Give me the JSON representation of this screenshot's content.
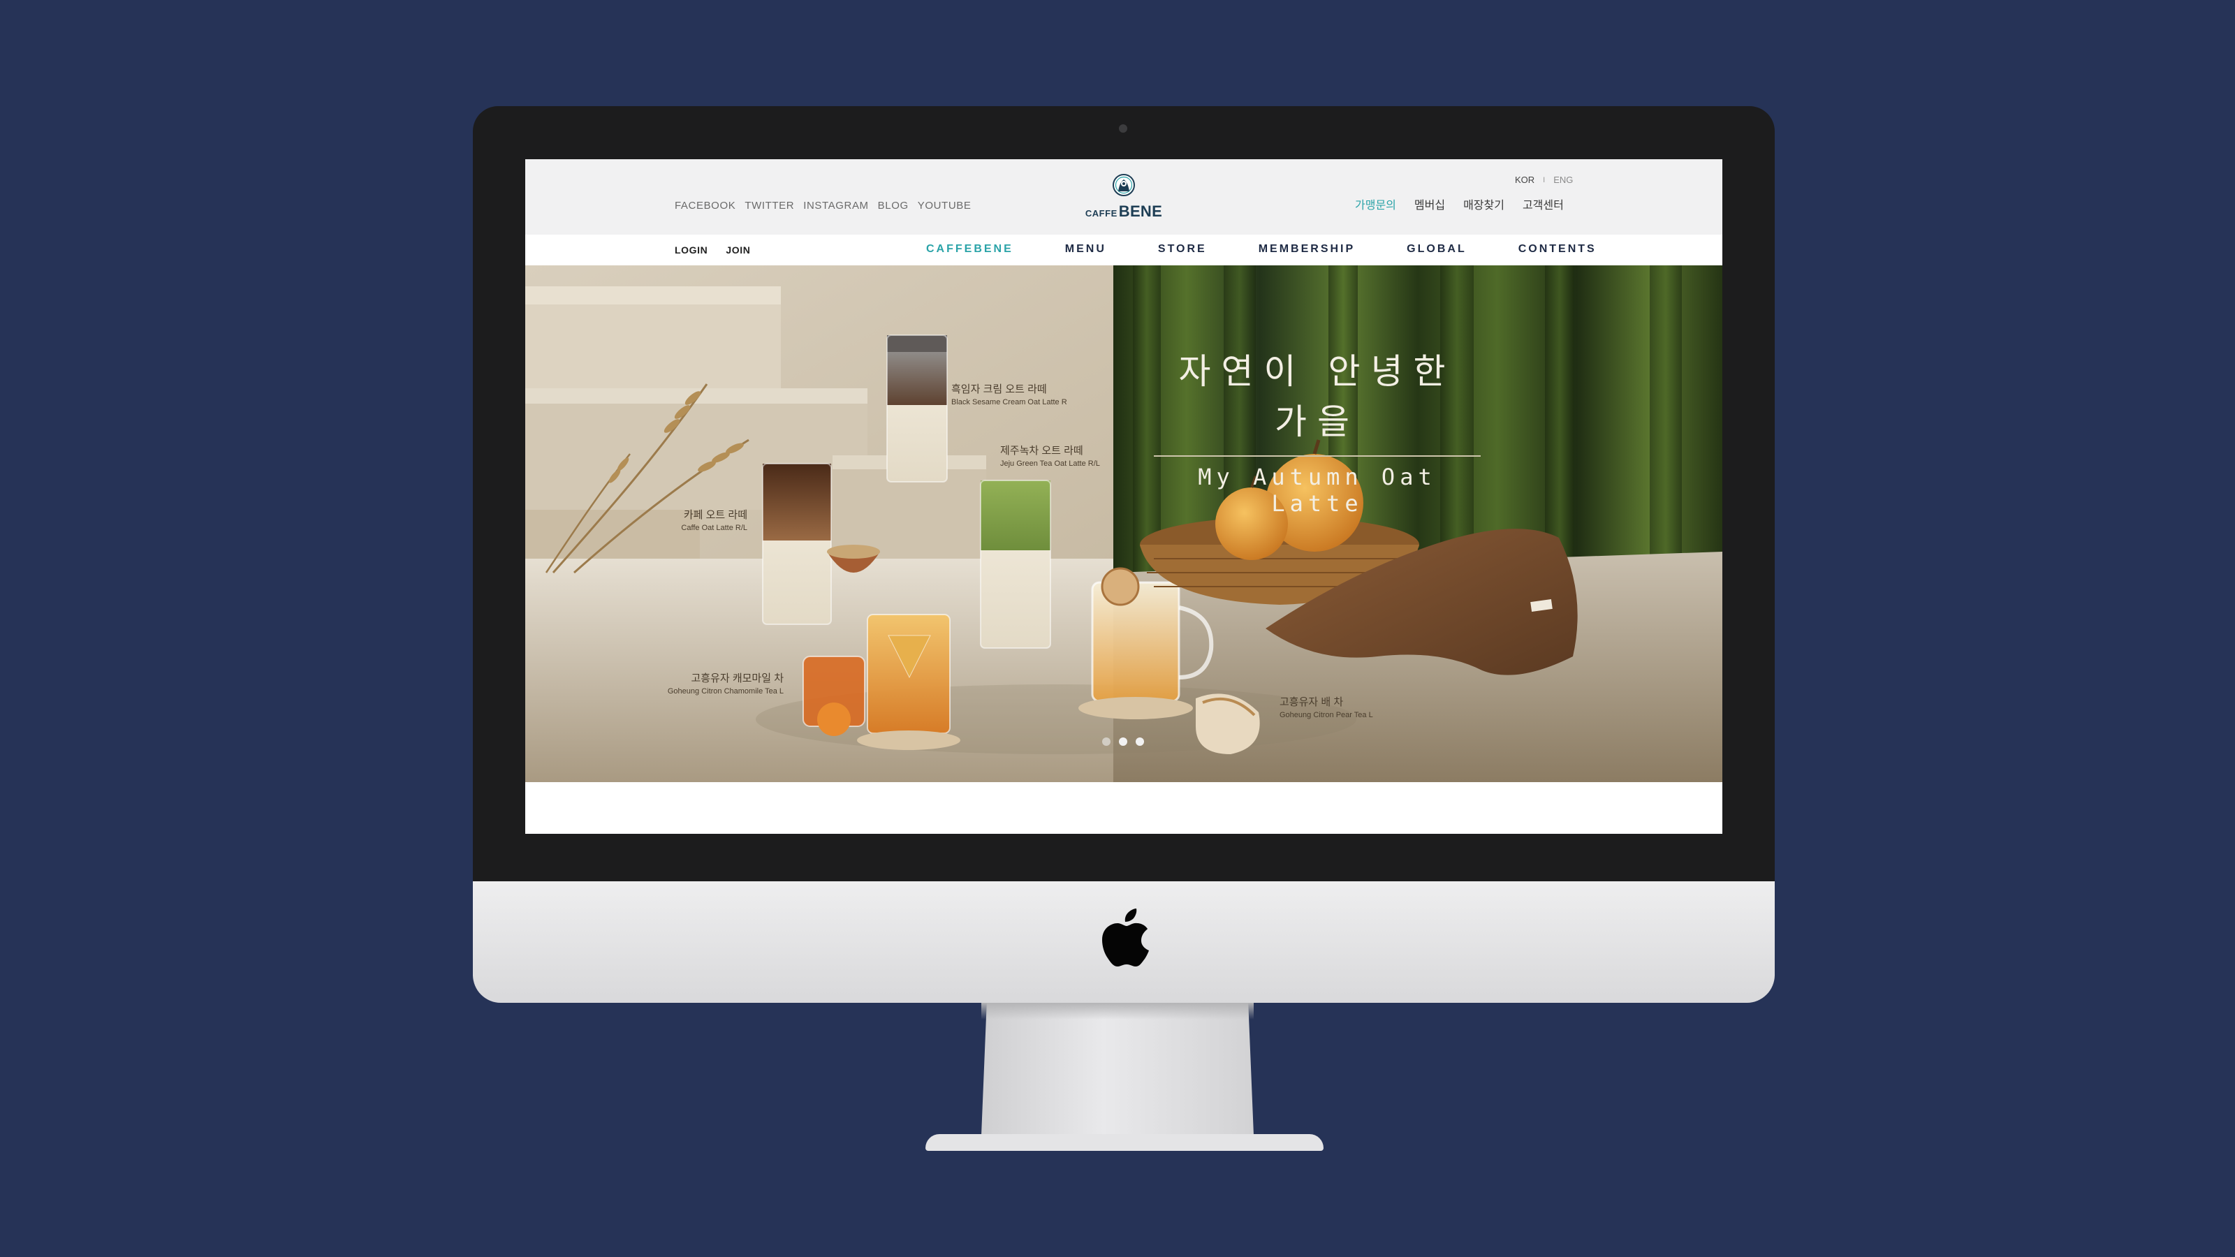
{
  "header": {
    "social_links": [
      "FACEBOOK",
      "TWITTER",
      "INSTAGRAM",
      "BLOG",
      "YOUTUBE"
    ],
    "logo": {
      "small": "CAFFE",
      "large": "BENE"
    },
    "languages": {
      "kor": "KOR",
      "separator": "I",
      "eng": "ENG"
    },
    "utility_links": [
      "가맹문의",
      "멤버십",
      "매장찾기",
      "고객센터"
    ],
    "accent_color": "#2aa3a8"
  },
  "nav": {
    "auth": [
      "LOGIN",
      "JOIN"
    ],
    "menu": [
      "CAFFEBENE",
      "MENU",
      "STORE",
      "MEMBERSHIP",
      "GLOBAL",
      "CONTENTS"
    ],
    "active": "CAFFEBENE"
  },
  "hero": {
    "headline_kr": "자연이 안녕한 가을",
    "headline_en": "My Autumn Oat Latte",
    "products": [
      {
        "kr": "흑임자 크림 오트 라떼",
        "en": "Black Sesame Cream Oat Latte R"
      },
      {
        "kr": "제주녹차 오트 라떼",
        "en": "Jeju Green Tea Oat Latte R/L"
      },
      {
        "kr": "카페 오트 라떼",
        "en": "Caffe Oat Latte R/L"
      },
      {
        "kr": "고흥유자 캐모마일 차",
        "en": "Goheung Citron Chamomile Tea L"
      },
      {
        "kr": "고흥유자 배 차",
        "en": "Goheung Citron Pear Tea L"
      }
    ],
    "slide_count": 3,
    "active_slide": 2
  },
  "device": {
    "background_color": "#263357"
  }
}
